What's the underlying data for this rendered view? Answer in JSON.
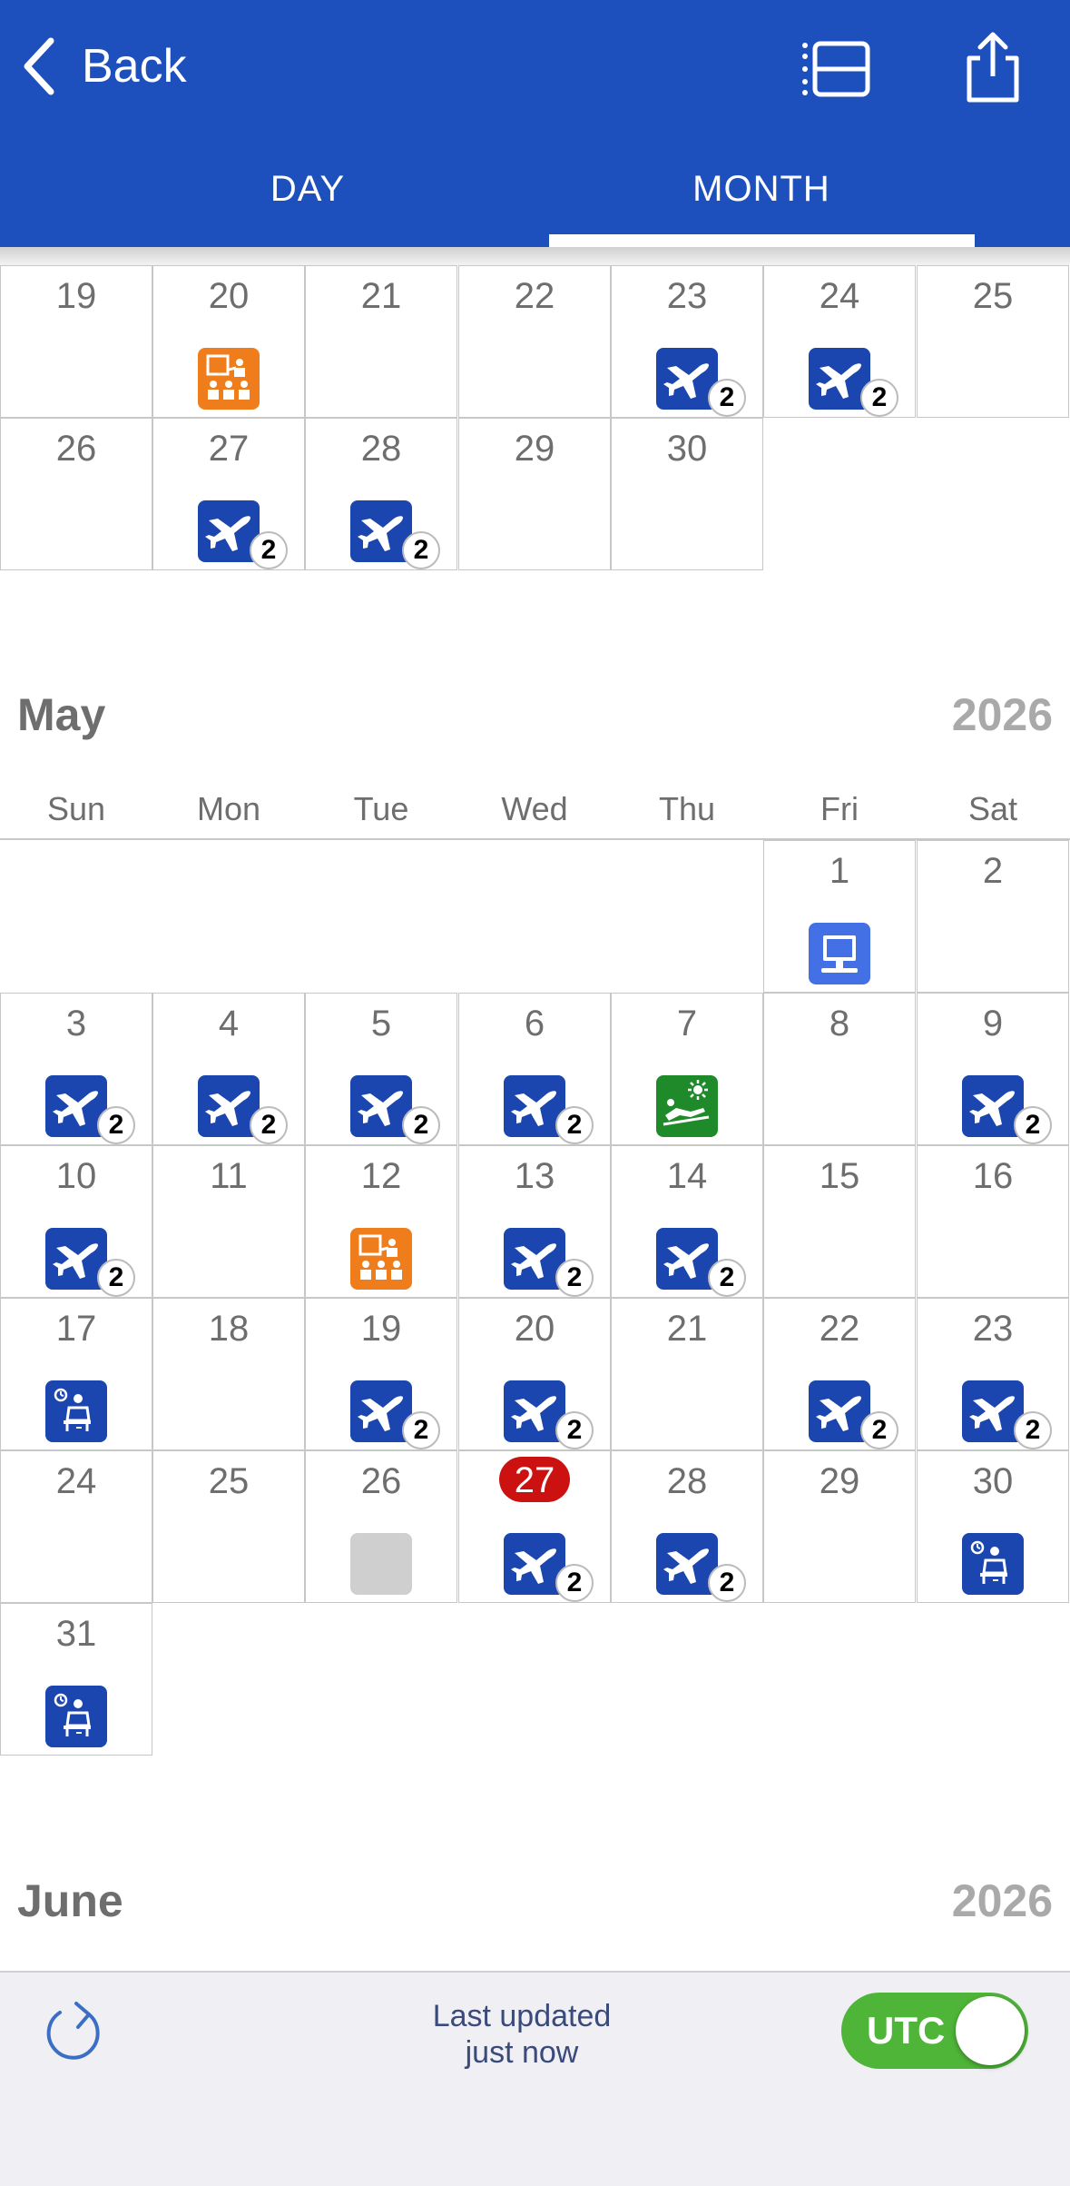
{
  "header": {
    "back_label": "Back",
    "tabs": [
      {
        "label": "DAY",
        "selected": false
      },
      {
        "label": "MONTH",
        "selected": true
      }
    ],
    "list_icon": "list-view-icon",
    "share_icon": "share-icon",
    "colors": {
      "bar": "#1e50bd",
      "text": "#ffffff"
    }
  },
  "april": {
    "weeks": [
      [
        {
          "day": "19"
        },
        {
          "day": "20",
          "event": "training"
        },
        {
          "day": "21"
        },
        {
          "day": "22"
        },
        {
          "day": "23",
          "event": "flight",
          "count": "2"
        },
        {
          "day": "24",
          "event": "flight",
          "count": "2"
        },
        {
          "day": "25"
        }
      ],
      [
        {
          "day": "26"
        },
        {
          "day": "27",
          "event": "flight",
          "count": "2"
        },
        {
          "day": "28",
          "event": "flight",
          "count": "2"
        },
        {
          "day": "29"
        },
        {
          "day": "30"
        }
      ]
    ]
  },
  "may": {
    "title": "May",
    "year": "2026",
    "weekdays": [
      "Sun",
      "Mon",
      "Tue",
      "Wed",
      "Thu",
      "Fri",
      "Sat"
    ],
    "weeks": [
      [
        null,
        null,
        null,
        null,
        null,
        {
          "day": "1",
          "event": "computer"
        },
        {
          "day": "2"
        }
      ],
      [
        {
          "day": "3",
          "event": "flight",
          "count": "2"
        },
        {
          "day": "4",
          "event": "flight",
          "count": "2"
        },
        {
          "day": "5",
          "event": "flight",
          "count": "2"
        },
        {
          "day": "6",
          "event": "flight",
          "count": "2"
        },
        {
          "day": "7",
          "event": "rest"
        },
        {
          "day": "8"
        },
        {
          "day": "9",
          "event": "flight",
          "count": "2"
        }
      ],
      [
        {
          "day": "10",
          "event": "flight",
          "count": "2"
        },
        {
          "day": "11"
        },
        {
          "day": "12",
          "event": "training"
        },
        {
          "day": "13",
          "event": "flight",
          "count": "2"
        },
        {
          "day": "14",
          "event": "flight",
          "count": "2"
        },
        {
          "day": "15"
        },
        {
          "day": "16"
        }
      ],
      [
        {
          "day": "17",
          "event": "standby"
        },
        {
          "day": "18"
        },
        {
          "day": "19",
          "event": "flight",
          "count": "2"
        },
        {
          "day": "20",
          "event": "flight",
          "count": "2"
        },
        {
          "day": "21"
        },
        {
          "day": "22",
          "event": "flight",
          "count": "2"
        },
        {
          "day": "23",
          "event": "flight",
          "count": "2"
        }
      ],
      [
        {
          "day": "24"
        },
        {
          "day": "25"
        },
        {
          "day": "26",
          "event": "blank"
        },
        {
          "day": "27",
          "event": "flight",
          "count": "2",
          "today": true
        },
        {
          "day": "28",
          "event": "flight",
          "count": "2"
        },
        {
          "day": "29"
        },
        {
          "day": "30",
          "event": "standby"
        }
      ],
      [
        {
          "day": "31",
          "event": "standby"
        }
      ]
    ]
  },
  "june": {
    "title": "June",
    "year": "2026"
  },
  "footer": {
    "refresh_icon": "refresh-icon",
    "updated_line1": "Last updated",
    "updated_line2": "just now",
    "toggle_label": "UTC",
    "toggle_on": true
  },
  "event_colors": {
    "flight": "#1b46b0",
    "training": "#f07d1b",
    "computer": "#4470e6",
    "rest": "#1f8a2a",
    "standby": "#1b46b0",
    "blank": "#cfcfcf",
    "today": "#cc1111"
  }
}
